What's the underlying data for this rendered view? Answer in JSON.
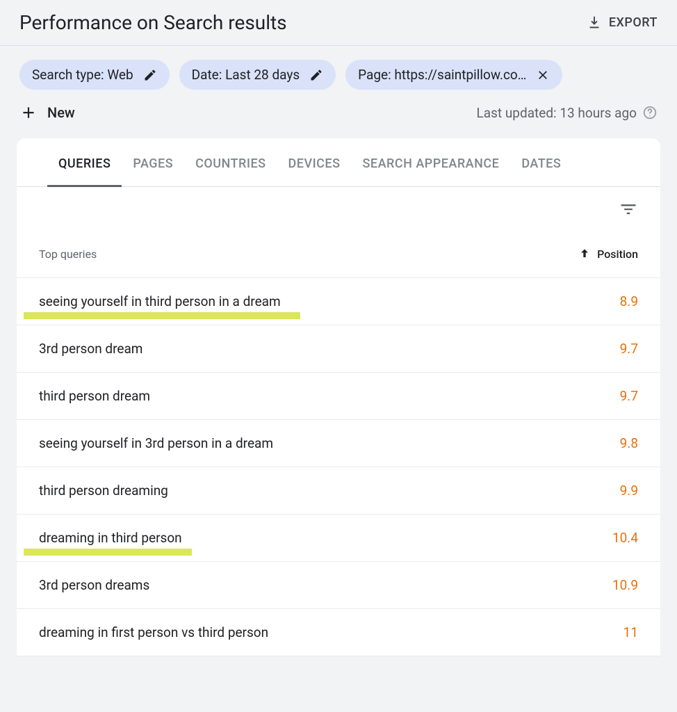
{
  "header": {
    "title": "Performance on Search results",
    "export_label": "EXPORT"
  },
  "filters": {
    "chips": [
      {
        "label": "Search type: Web",
        "icon": "edit"
      },
      {
        "label": "Date: Last 28 days",
        "icon": "edit"
      },
      {
        "label": "Page: https://saintpillow.co…",
        "icon": "close"
      }
    ],
    "new_label": "New",
    "last_updated": "Last updated: 13 hours ago"
  },
  "tabs": [
    {
      "label": "QUERIES",
      "active": true
    },
    {
      "label": "PAGES",
      "active": false
    },
    {
      "label": "COUNTRIES",
      "active": false
    },
    {
      "label": "DEVICES",
      "active": false
    },
    {
      "label": "SEARCH APPEARANCE",
      "active": false
    },
    {
      "label": "DATES",
      "active": false
    }
  ],
  "table": {
    "header_left": "Top queries",
    "header_right": "Position",
    "rows": [
      {
        "query": "seeing yourself in third person in a dream",
        "position": "8.9",
        "highlight_width": 398
      },
      {
        "query": "3rd person dream",
        "position": "9.7"
      },
      {
        "query": "third person dream",
        "position": "9.7"
      },
      {
        "query": "seeing yourself in 3rd person in a dream",
        "position": "9.8"
      },
      {
        "query": "third person dreaming",
        "position": "9.9"
      },
      {
        "query": "dreaming in third person",
        "position": "10.4",
        "highlight_width": 242
      },
      {
        "query": "3rd person dreams",
        "position": "10.9"
      },
      {
        "query": "dreaming in first person vs third person",
        "position": "11"
      }
    ]
  }
}
